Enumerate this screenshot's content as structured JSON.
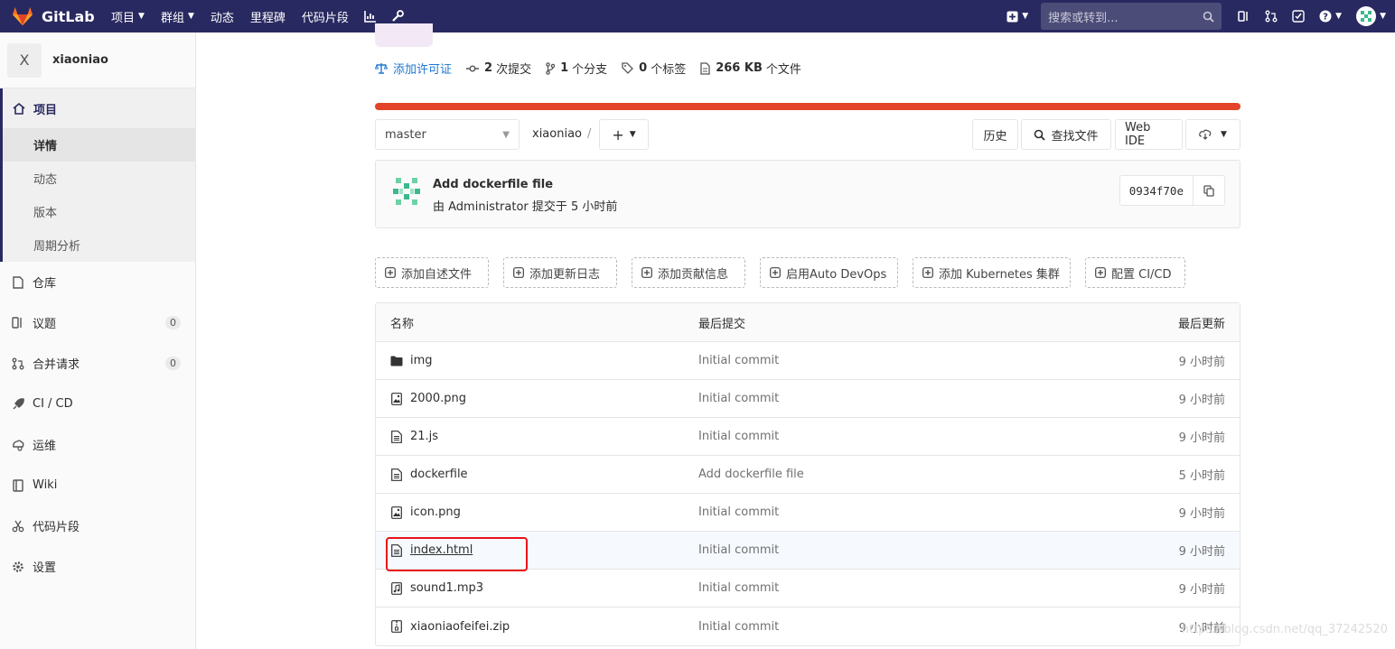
{
  "navbar": {
    "brand": "GitLab",
    "items": [
      {
        "label": "项目",
        "dropdown": true
      },
      {
        "label": "群组",
        "dropdown": true
      },
      {
        "label": "动态",
        "dropdown": false
      },
      {
        "label": "里程碑",
        "dropdown": false
      },
      {
        "label": "代码片段",
        "dropdown": false
      }
    ],
    "search_placeholder": "搜索或转到..."
  },
  "sidebar": {
    "project_avatar_letter": "X",
    "project_name": "xiaoniao",
    "project_section": "项目",
    "project_sub": [
      "详情",
      "动态",
      "版本",
      "周期分析"
    ],
    "items": [
      {
        "label": "仓库",
        "icon": "repo-icon",
        "count": null
      },
      {
        "label": "议题",
        "icon": "issues-icon",
        "count": "0"
      },
      {
        "label": "合并请求",
        "icon": "merge-request-icon",
        "count": "0"
      },
      {
        "label": "CI / CD",
        "icon": "rocket-icon",
        "count": null
      },
      {
        "label": "运维",
        "icon": "operations-icon",
        "count": null
      },
      {
        "label": "Wiki",
        "icon": "book-icon",
        "count": null
      },
      {
        "label": "代码片段",
        "icon": "scissors-icon",
        "count": null
      },
      {
        "label": "设置",
        "icon": "gear-icon",
        "count": null
      }
    ]
  },
  "stats": {
    "license": "添加许可证",
    "commits_count": "2",
    "commits_label": "次提交",
    "branches_count": "1",
    "branches_label": "个分支",
    "tags_count": "0",
    "tags_label": "个标签",
    "size_value": "266 KB",
    "size_label": "个文件"
  },
  "toolbar": {
    "branch": "master",
    "project_crumb": "xiaoniao",
    "separator": "/",
    "history": "历史",
    "find_file": "查找文件",
    "web_ide": "Web IDE"
  },
  "commit": {
    "title": "Add dockerfile file",
    "meta": "由 Administrator 提交于 5 小时前",
    "sha": "0934f70e"
  },
  "suggestions": [
    "添加自述文件",
    "添加更新日志",
    "添加贡献信息",
    "启用Auto DevOps",
    "添加 Kubernetes 集群",
    "配置 CI/CD"
  ],
  "table": {
    "headers": {
      "name": "名称",
      "last_commit": "最后提交",
      "last_update": "最后更新"
    },
    "rows": [
      {
        "name": "img",
        "type": "folder",
        "commit": "Initial commit",
        "time": "9 小时前"
      },
      {
        "name": "2000.png",
        "type": "image",
        "commit": "Initial commit",
        "time": "9 小时前"
      },
      {
        "name": "21.js",
        "type": "file",
        "commit": "Initial commit",
        "time": "9 小时前"
      },
      {
        "name": "dockerfile",
        "type": "file",
        "commit": "Add dockerfile file",
        "time": "5 小时前"
      },
      {
        "name": "icon.png",
        "type": "image",
        "commit": "Initial commit",
        "time": "9 小时前"
      },
      {
        "name": "index.html",
        "type": "file",
        "commit": "Initial commit",
        "time": "9 小时前"
      },
      {
        "name": "sound1.mp3",
        "type": "audio",
        "commit": "Initial commit",
        "time": "9 小时前"
      },
      {
        "name": "xiaoniaofeifei.zip",
        "type": "archive",
        "commit": "Initial commit",
        "time": "9 小时前"
      }
    ]
  },
  "watermark": "https://blog.csdn.net/qq_37242520",
  "colors": {
    "navbar": "#292961",
    "accent": "#e24329",
    "highlight": "#e8111b",
    "link": "#1f78d1"
  }
}
